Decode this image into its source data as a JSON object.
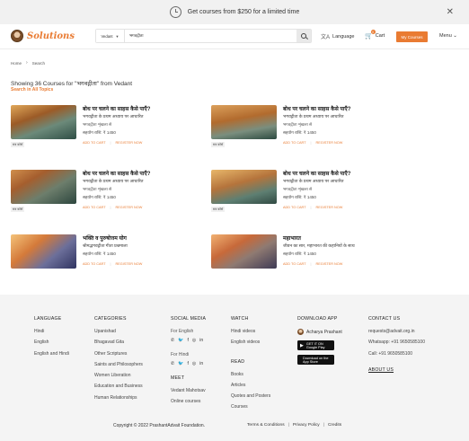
{
  "promo": {
    "text": "Get courses from $250 for a limited time",
    "close": "✕"
  },
  "header": {
    "logo_text": "Solutions",
    "search_scope": "Vedant",
    "search_value": "भगवद्गीता",
    "language_label": "Language",
    "cart_label": "Cart",
    "cart_count": "0",
    "my_courses_label": "My Courses",
    "menu_label": "Menu"
  },
  "breadcrumb": {
    "home": "Home",
    "current": "Search"
  },
  "results": {
    "title": "Showing 36 Courses for \"भगवद्गीता\" from Vedant",
    "search_all": "Search in All Topics"
  },
  "courses": [
    {
      "title": "बोध पर चलने का साहस कैसे पाएँ?",
      "line1": "भगवद्गीता के प्रथम अध्याय पर आधारित",
      "line2": "भगवद्गीता शृंखला से",
      "price": "सहयोग राशि: ₹ 1450",
      "tag": "सत्र कोर्स",
      "add_to_cart": "ADD TO CART",
      "register": "REGISTER NOW"
    },
    {
      "title": "बोध पर चलने का साहस कैसे पाएँ?",
      "line1": "भगवद्गीता के प्रथम अध्याय पर आधारित",
      "line2": "भगवद्गीता शृंखला से",
      "price": "सहयोग राशि: ₹ 1450",
      "tag": "सत्र कोर्स",
      "add_to_cart": "ADD TO CART",
      "register": "REGISTER NOW"
    },
    {
      "title": "बोध पर चलने का साहस कैसे पाएँ?",
      "line1": "भगवद्गीता के प्रथम अध्याय पर आधारित",
      "line2": "भगवद्गीता शृंखला से",
      "price": "सहयोग राशि: ₹ 1450",
      "tag": "सत्र कोर्स",
      "add_to_cart": "ADD TO CART",
      "register": "REGISTER NOW"
    },
    {
      "title": "बोध पर चलने का साहस कैसे पाएँ?",
      "line1": "भगवद्गीता के प्रथम अध्याय पर आधारित",
      "line2": "भगवद्गीता शृंखला से",
      "price": "सहयोग राशि: ₹ 1450",
      "tag": "सत्र कोर्स",
      "add_to_cart": "ADD TO CART",
      "register": "REGISTER NOW"
    },
    {
      "title": "भक्ति व पुरुषोत्तम योग",
      "line1": "श्रीमद्भगवद्गीता गीता प्रश्नमाला",
      "price": "सहयोग राशि: ₹ 1450",
      "add_to_cart": "ADD TO CART",
      "register": "REGISTER NOW"
    },
    {
      "title": "महाभारत",
      "line1": "जीवन का सार, महाभारत की कहानियों के साथ",
      "price": "सहयोग राशि: ₹ 1450",
      "add_to_cart": "ADD TO CART",
      "register": "REGISTER NOW"
    }
  ],
  "footer": {
    "language": {
      "heading": "LANGUAGE",
      "items": [
        "Hindi",
        "English",
        "English and Hindi"
      ]
    },
    "categories": {
      "heading": "CATEGORIES",
      "items": [
        "Upanishad",
        "Bhagavad Gita",
        "Other Scriptures",
        "Saints and Philosophers",
        "Women Liberation",
        "Education and Business",
        "Human Relationships"
      ]
    },
    "social": {
      "heading": "SOCIAL MEDIA",
      "for_english": "For English",
      "for_hindi": "For Hindi"
    },
    "meet": {
      "heading": "MEET",
      "items": [
        "Vedant Mahotsav",
        "Online courses"
      ]
    },
    "watch": {
      "heading": "WATCH",
      "items": [
        "Hindi videos",
        "English videos"
      ]
    },
    "read": {
      "heading": "READ",
      "items": [
        "Books",
        "Articles",
        "Quotes and Posters",
        "Courses"
      ]
    },
    "download": {
      "heading": "DOWNLOAD APP",
      "app_name": "Acharya Prashant",
      "google_play": "GET IT ON Google Play",
      "app_store": "Download on the App Store"
    },
    "contact": {
      "heading": "CONTACT US",
      "email": "requests@advait.org.in",
      "whatsapp": "Whatsapp: +91 9650585100",
      "call": "Call: +91 9650585100",
      "about": "ABOUT US"
    },
    "copyright": "Copyright © 2022 PrashantAdvait Foundation.",
    "links": [
      "Terms & Conditions",
      "Privacy Policy",
      "Credits"
    ]
  }
}
